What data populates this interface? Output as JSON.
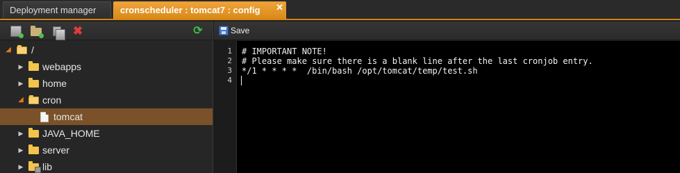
{
  "tabs": [
    {
      "label": "Deployment manager",
      "active": false
    },
    {
      "label": "cronscheduler : tomcat7 : config",
      "active": true,
      "close": "✕"
    }
  ],
  "left_toolbar": {
    "icons": [
      "new-file-icon",
      "new-folder-icon",
      "copy-icon",
      "delete-icon",
      "refresh-icon"
    ],
    "delete_glyph": "✖",
    "refresh_glyph": "⟳"
  },
  "tree": [
    {
      "label": "/",
      "expanded": true,
      "type": "folder"
    },
    {
      "label": "webapps",
      "expanded": false,
      "type": "folder"
    },
    {
      "label": "home",
      "expanded": false,
      "type": "folder"
    },
    {
      "label": "cron",
      "expanded": true,
      "type": "folder"
    },
    {
      "label": "tomcat",
      "type": "file",
      "selected": true
    },
    {
      "label": "JAVA_HOME",
      "expanded": false,
      "type": "folder"
    },
    {
      "label": "server",
      "expanded": false,
      "type": "folder"
    },
    {
      "label": "lib",
      "expanded": false,
      "type": "folder-locked"
    }
  ],
  "arrows": {
    "open": "◢",
    "closed": "▶"
  },
  "editor_toolbar": {
    "save_label": "Save"
  },
  "editor": {
    "line_numbers": [
      "1",
      "2",
      "3",
      "4"
    ],
    "lines": [
      "# IMPORTANT NOTE!",
      "# Please make sure there is a blank line after the last cronjob entry.",
      "*/1 * * * *  /bin/bash /opt/tomcat/temp/test.sh",
      ""
    ]
  },
  "colors": {
    "accent": "#d68412",
    "selection": "#7a5128",
    "folder": "#f2c44b"
  }
}
